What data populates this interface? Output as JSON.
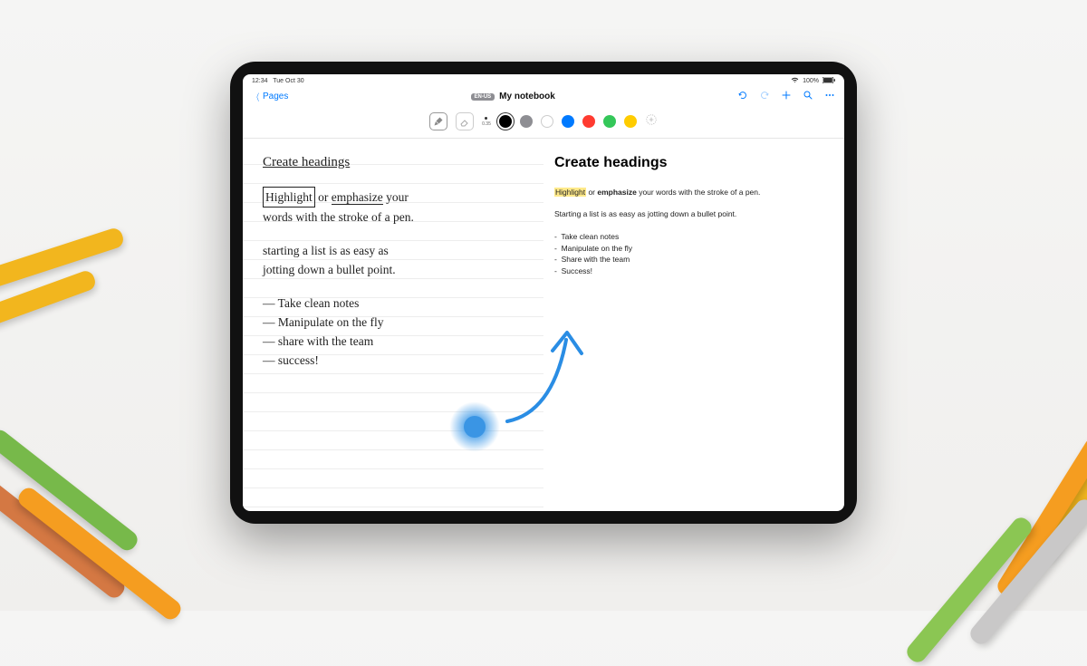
{
  "statusbar": {
    "time": "12:34",
    "date": "Tue Oct 30",
    "battery": "100%"
  },
  "nav": {
    "back_label": "Pages",
    "lang_badge": "EN-US",
    "title": "My notebook"
  },
  "toolbar": {
    "stroke_label": "0.35",
    "colors": [
      "#000000",
      "#8e8e93",
      "#ffffff",
      "#007aff",
      "#ff3b30",
      "#34c759",
      "#ffcc00"
    ]
  },
  "handwriting": {
    "heading": "Create headings",
    "boxed_word": "Highlight",
    "emphasize_word": "emphasize",
    "line1_rest_a": " or ",
    "line1_rest_b": " your",
    "line2": "words with the stroke of a pen.",
    "para2_l1": "starting a list is as easy as",
    "para2_l2": "jotting down a bullet point.",
    "list": [
      "Take clean notes",
      "Manipulate on the fly",
      "share with the team",
      "success!"
    ]
  },
  "rendered": {
    "heading": "Create headings",
    "highlight_word": "Highlight",
    "emphasize_word": "emphasize",
    "line1_a": " or ",
    "line1_b": " your words with the stroke of a pen.",
    "para2": "Starting a list is as easy as jotting down a bullet point.",
    "list": [
      "Take clean notes",
      "Manipulate on the fly",
      "Share with the team",
      "Success!"
    ]
  }
}
